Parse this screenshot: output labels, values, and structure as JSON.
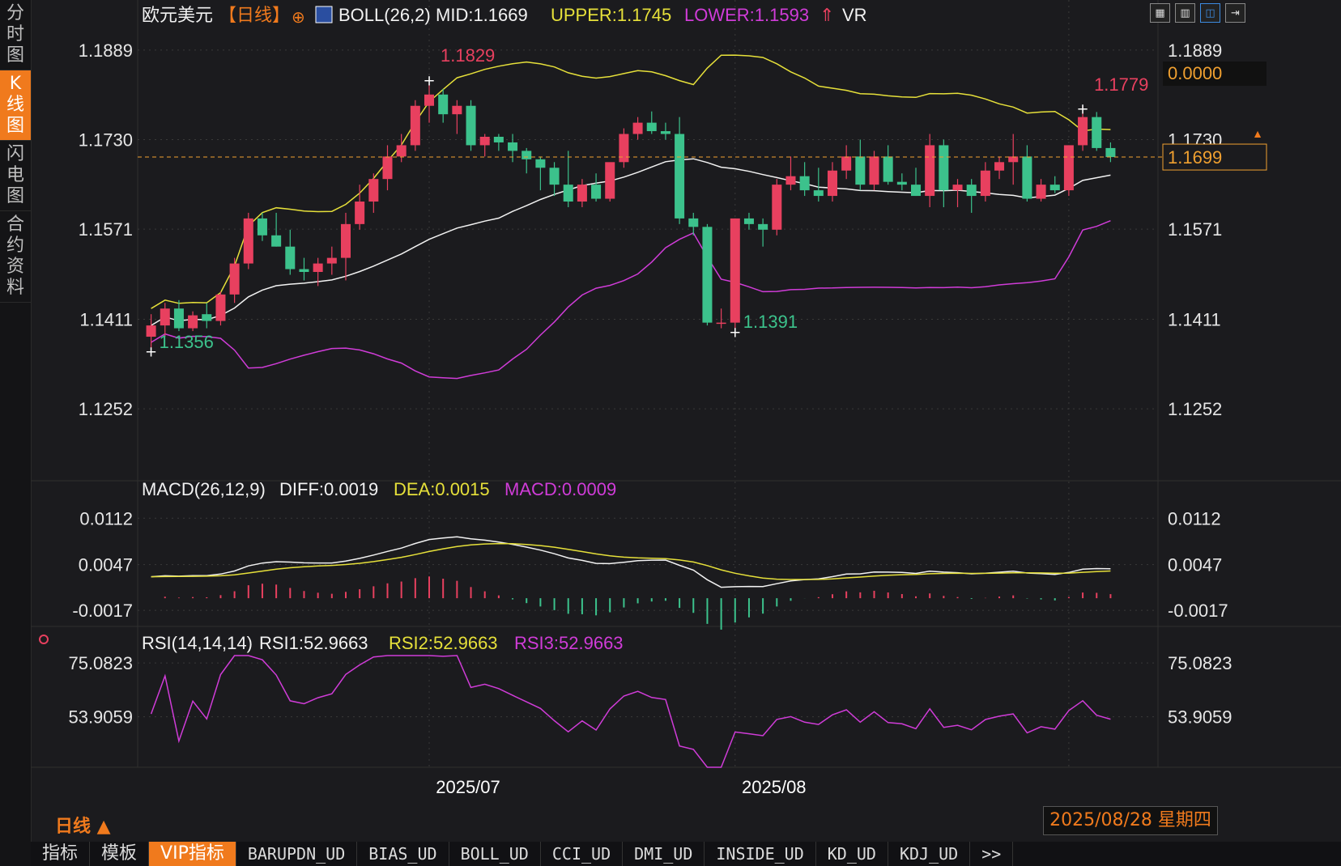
{
  "sidebar": {
    "tabs": [
      "分时图",
      "K线图",
      "闪电图",
      "合约资料"
    ],
    "active_index": 1
  },
  "header": {
    "symbol": "欧元美元",
    "period_tag": "【日线】",
    "boll_label": "BOLL(26,2)",
    "mid": "MID:1.1669",
    "upper": "UPPER:1.1745",
    "lower": "LOWER:1.1593",
    "vr_label": "VR"
  },
  "colors": {
    "up": "#e8405f",
    "down": "#3cc28c",
    "upper_band": "#e6e03a",
    "lower_band": "#d03cd8",
    "mid_band": "#f2f2f2",
    "accent": "#f07a1d",
    "grid": "#3a3a3a"
  },
  "price_axis": {
    "ticks": [
      "1.1889",
      "1.1730",
      "1.1571",
      "1.1411",
      "1.1252"
    ]
  },
  "price_markers": {
    "last_price": "1.1699",
    "top_right_value": "0.0000",
    "high_label": "1.1829",
    "low_label": "1.1356",
    "low2_label": "1.1391",
    "recent_high_label": "1.1779"
  },
  "macd": {
    "label": "MACD(26,12,9)",
    "diff": "DIFF:0.0019",
    "dea": "DEA:0.0015",
    "macd": "MACD:0.0009",
    "ticks": [
      "0.0112",
      "0.0047",
      "-0.0017"
    ]
  },
  "rsi": {
    "label": "RSI(14,14,14)",
    "rsi1": "RSI1:52.9663",
    "rsi2": "RSI2:52.9663",
    "rsi3": "RSI3:52.9663",
    "ticks": [
      "75.0823",
      "53.9059"
    ]
  },
  "x_axis": {
    "labels": [
      "2025/07",
      "2025/08"
    ]
  },
  "period_label": "日线",
  "date_badge": "2025/08/28 星期四",
  "bottom_tabs": [
    "指标",
    "模板",
    "VIP指标",
    "BARUPDN_UD",
    "BIAS_UD",
    "BOLL_UD",
    "CCI_UD",
    "DMI_UD",
    "INSIDE_UD",
    "KD_UD",
    "KDJ_UD",
    ">>"
  ],
  "bottom_active_index": 2,
  "toolbar_icons": [
    "grid-layout-icon",
    "chart-layout-icon",
    "indicator-layout-icon",
    "export-icon"
  ],
  "chart_data": {
    "type": "candlestick",
    "ohlc": [
      [
        1.138,
        1.142,
        1.1356,
        1.14
      ],
      [
        1.14,
        1.144,
        1.138,
        1.143
      ],
      [
        1.143,
        1.1445,
        1.139,
        1.1395
      ],
      [
        1.1395,
        1.1425,
        1.139,
        1.1418
      ],
      [
        1.142,
        1.144,
        1.1395,
        1.1408
      ],
      [
        1.1408,
        1.146,
        1.14,
        1.1455
      ],
      [
        1.1455,
        1.152,
        1.144,
        1.151
      ],
      [
        1.151,
        1.16,
        1.15,
        1.159
      ],
      [
        1.159,
        1.16,
        1.155,
        1.156
      ],
      [
        1.156,
        1.16,
        1.154,
        1.154
      ],
      [
        1.154,
        1.157,
        1.149,
        1.15
      ],
      [
        1.15,
        1.152,
        1.148,
        1.1495
      ],
      [
        1.1495,
        1.152,
        1.147,
        1.151
      ],
      [
        1.151,
        1.154,
        1.149,
        1.152
      ],
      [
        1.152,
        1.16,
        1.148,
        1.158
      ],
      [
        1.158,
        1.165,
        1.157,
        1.162
      ],
      [
        1.162,
        1.167,
        1.16,
        1.166
      ],
      [
        1.166,
        1.172,
        1.164,
        1.17
      ],
      [
        1.17,
        1.174,
        1.169,
        1.172
      ],
      [
        1.172,
        1.18,
        1.171,
        1.179
      ],
      [
        1.179,
        1.1829,
        1.176,
        1.181
      ],
      [
        1.181,
        1.182,
        1.176,
        1.1775
      ],
      [
        1.1775,
        1.18,
        1.174,
        1.179
      ],
      [
        1.179,
        1.18,
        1.171,
        1.172
      ],
      [
        1.172,
        1.174,
        1.17,
        1.1735
      ],
      [
        1.1735,
        1.174,
        1.171,
        1.1725
      ],
      [
        1.1725,
        1.174,
        1.169,
        1.171
      ],
      [
        1.171,
        1.1715,
        1.167,
        1.1695
      ],
      [
        1.1695,
        1.17,
        1.164,
        1.168
      ],
      [
        1.168,
        1.169,
        1.163,
        1.165
      ],
      [
        1.165,
        1.171,
        1.161,
        1.162
      ],
      [
        1.162,
        1.166,
        1.161,
        1.165
      ],
      [
        1.165,
        1.167,
        1.162,
        1.1625
      ],
      [
        1.1625,
        1.166,
        1.162,
        1.169
      ],
      [
        1.169,
        1.175,
        1.168,
        1.174
      ],
      [
        1.174,
        1.177,
        1.173,
        1.176
      ],
      [
        1.176,
        1.178,
        1.174,
        1.1745
      ],
      [
        1.1745,
        1.176,
        1.173,
        1.174
      ],
      [
        1.174,
        1.177,
        1.158,
        1.159
      ],
      [
        1.159,
        1.16,
        1.156,
        1.1575
      ],
      [
        1.1575,
        1.158,
        1.14,
        1.1405
      ],
      [
        1.1405,
        1.143,
        1.1395,
        1.1405
      ],
      [
        1.1405,
        1.159,
        1.1391,
        1.159
      ],
      [
        1.159,
        1.16,
        1.157,
        1.158
      ],
      [
        1.158,
        1.159,
        1.154,
        1.157
      ],
      [
        1.157,
        1.166,
        1.156,
        1.165
      ],
      [
        1.165,
        1.17,
        1.164,
        1.1665
      ],
      [
        1.1665,
        1.169,
        1.163,
        1.164
      ],
      [
        1.164,
        1.168,
        1.162,
        1.163
      ],
      [
        1.163,
        1.169,
        1.162,
        1.1675
      ],
      [
        1.1675,
        1.172,
        1.166,
        1.17
      ],
      [
        1.17,
        1.173,
        1.164,
        1.165
      ],
      [
        1.165,
        1.171,
        1.164,
        1.17
      ],
      [
        1.17,
        1.172,
        1.165,
        1.1655
      ],
      [
        1.1655,
        1.167,
        1.164,
        1.165
      ],
      [
        1.165,
        1.168,
        1.163,
        1.163
      ],
      [
        1.163,
        1.174,
        1.161,
        1.172
      ],
      [
        1.172,
        1.173,
        1.161,
        1.164
      ],
      [
        1.164,
        1.166,
        1.161,
        1.165
      ],
      [
        1.165,
        1.166,
        1.16,
        1.163
      ],
      [
        1.163,
        1.169,
        1.162,
        1.1675
      ],
      [
        1.1675,
        1.17,
        1.166,
        1.169
      ],
      [
        1.169,
        1.174,
        1.165,
        1.17
      ],
      [
        1.17,
        1.172,
        1.162,
        1.1625
      ],
      [
        1.1625,
        1.166,
        1.162,
        1.165
      ],
      [
        1.165,
        1.1665,
        1.1635,
        1.164
      ],
      [
        1.164,
        1.172,
        1.163,
        1.172
      ],
      [
        1.172,
        1.179,
        1.171,
        1.177
      ],
      [
        1.177,
        1.1779,
        1.171,
        1.1715
      ],
      [
        1.1715,
        1.1725,
        1.169,
        1.1699
      ]
    ],
    "ylim": [
      1.113,
      1.1929
    ],
    "xlabel": "",
    "ylabel": ""
  }
}
